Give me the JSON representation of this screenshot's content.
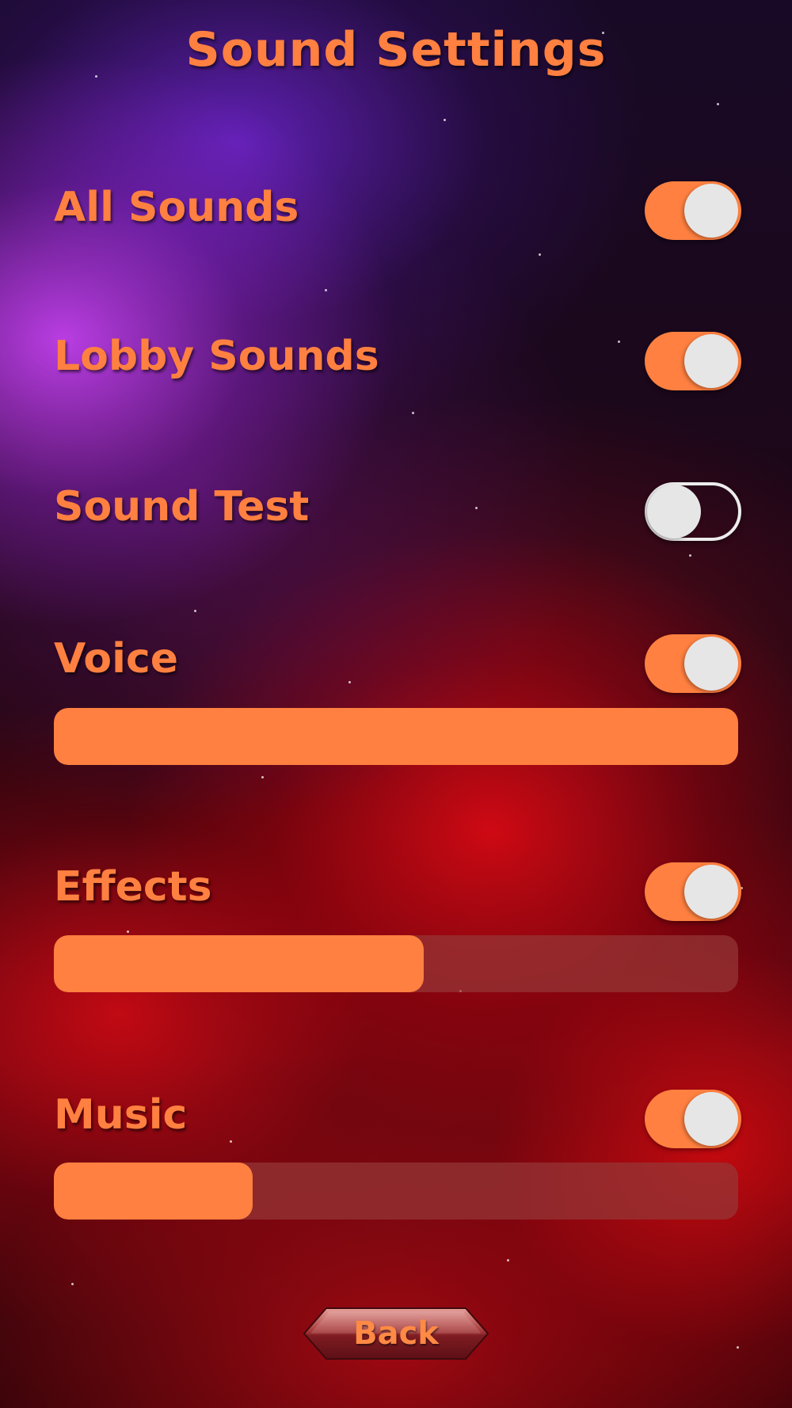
{
  "title": "Sound Settings",
  "colors": {
    "accent": "#ff8040",
    "track": "#963737",
    "knob": "#e6e6e6"
  },
  "settings": [
    {
      "label": "All Sounds",
      "enabled": true
    },
    {
      "label": "Lobby Sounds",
      "enabled": true
    },
    {
      "label": "Sound Test",
      "enabled": false
    },
    {
      "label": "Voice",
      "enabled": true,
      "level": 1.0
    },
    {
      "label": "Effects",
      "enabled": true,
      "level": 0.54
    },
    {
      "label": "Music",
      "enabled": true,
      "level": 0.29
    }
  ],
  "back_label": "Back"
}
